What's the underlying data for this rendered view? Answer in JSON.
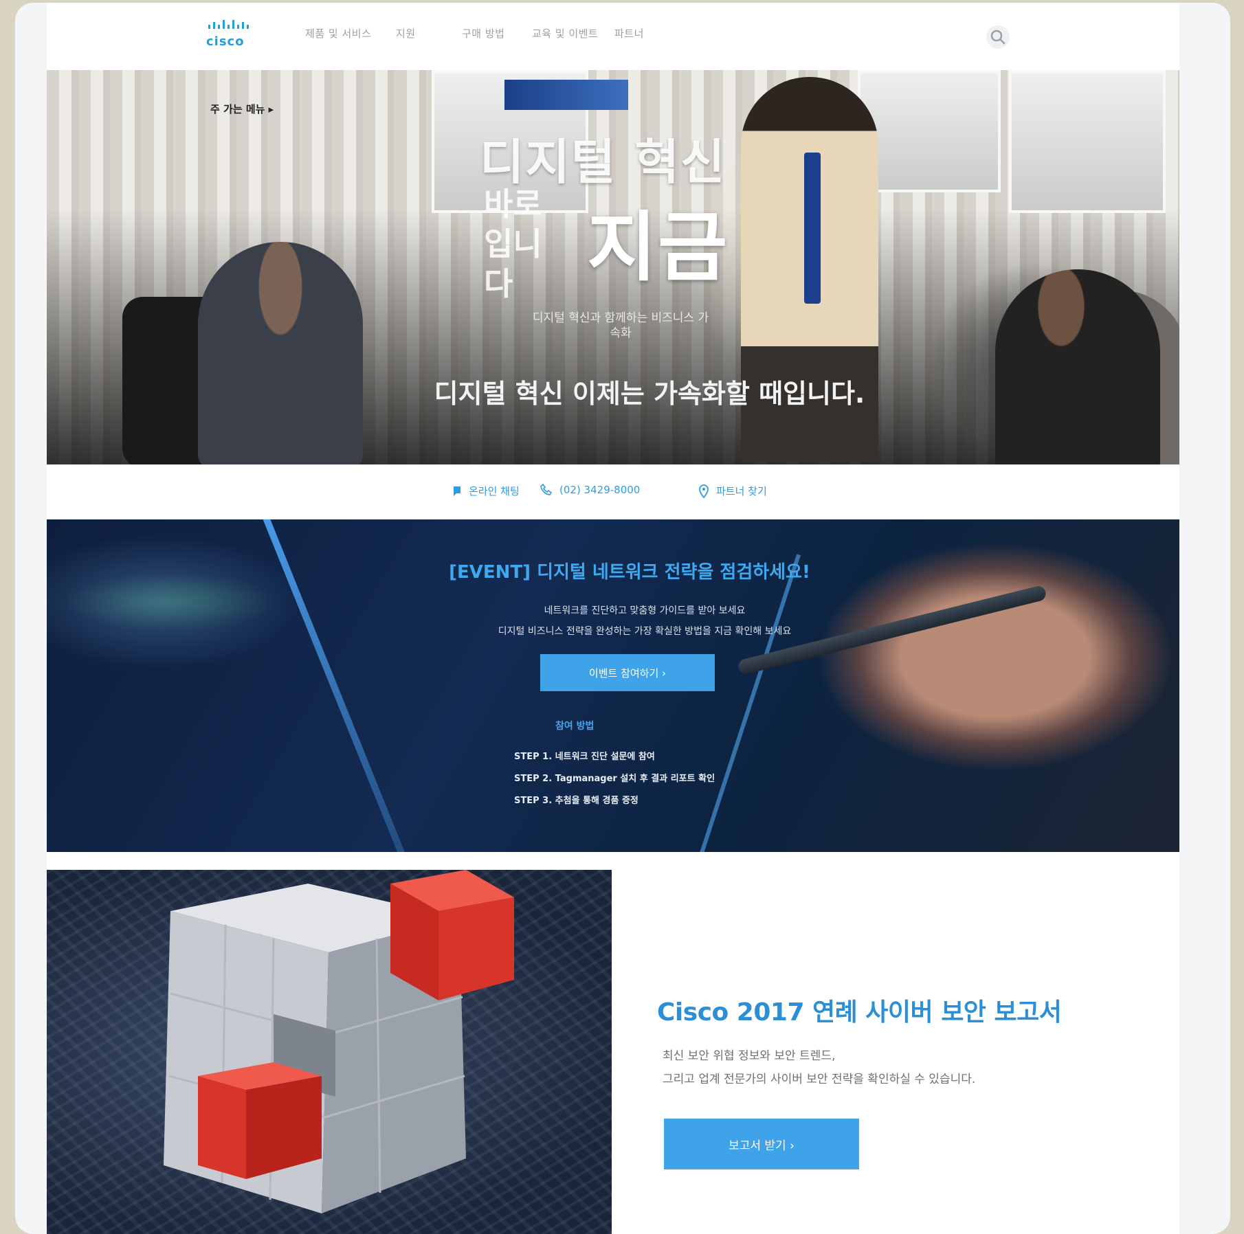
{
  "header": {
    "logo_text": "cisco",
    "nav": [
      "제품 및 서비스",
      "지원",
      "구매 방법",
      "교육 및 이벤트",
      "파트너"
    ]
  },
  "hero": {
    "tag": "주 가는 메뉴 ▸",
    "title_line1": "디지털 혁신",
    "title_line2": "바로 입니다",
    "title_big": "지금",
    "caption": "디지털 혁신과 함께하는 비즈니스 가속화",
    "headline": "디지털 혁신 이제는 가속화할 때입니다."
  },
  "contact": {
    "chat": "온라인 채팅",
    "phone": "(02) 3429-8000",
    "location": "파트너 찾기"
  },
  "event": {
    "title": "[EVENT] 디지털 네트워크 전략을 점검하세요!",
    "desc_line1": "네트워크를 진단하고 맞춤형 가이드를 받아 보세요",
    "desc_line2": "디지털 비즈니스 전략을 완성하는 가장 확실한 방법을 지금 확인해 보세요",
    "button": "이벤트 참여하기 ›",
    "sub_heading": "참여 방법",
    "steps": [
      "STEP 1. 네트워크 진단 설문에 참여",
      "STEP 2. Tagmanager 설치 후 결과 리포트 확인",
      "STEP 3. 추첨을 통해 경품 증정"
    ]
  },
  "report": {
    "title": "Cisco 2017 연례 사이버 보안 보고서",
    "desc_line1": "최신 보안 위협 정보와 보안 트렌드,",
    "desc_line2": "그리고 업계 전문가의 사이버 보안 전략을 확인하실 수 있습니다.",
    "button": "보고서 받기 ›"
  },
  "colors": {
    "accent": "#3ea3e8",
    "title_blue": "#2c8fd6",
    "cube_red": "#d8352a"
  }
}
